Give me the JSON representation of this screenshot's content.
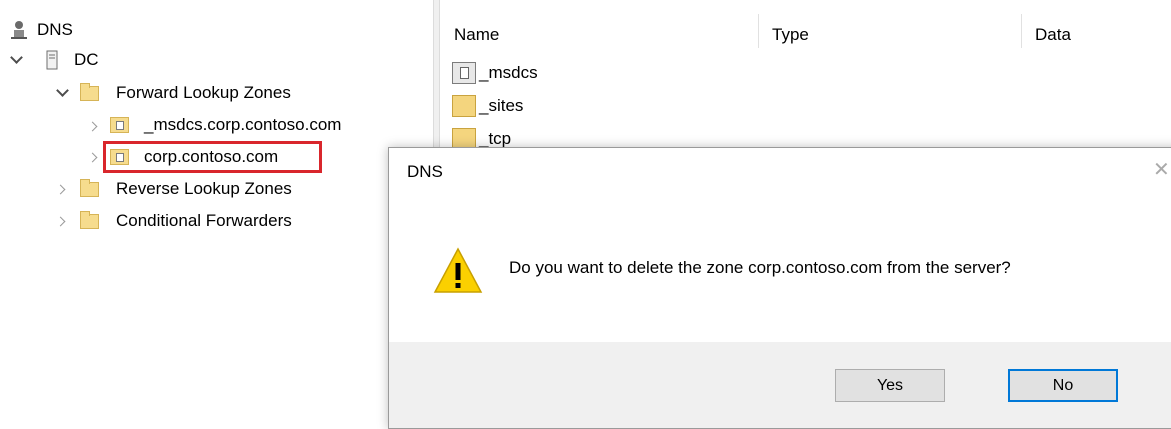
{
  "tree": {
    "root": "DNS",
    "server": "DC",
    "forward_zones": "Forward Lookup Zones",
    "zone_msdcs": "_msdcs.corp.contoso.com",
    "zone_corp": "corp.contoso.com",
    "reverse_zones": "Reverse Lookup Zones",
    "conditional_forwarders": "Conditional Forwarders"
  },
  "list": {
    "columns": [
      "Name",
      "Type",
      "Data"
    ],
    "rows": [
      "_msdcs",
      "_sites",
      "_tcp"
    ]
  },
  "dialog": {
    "title": "DNS",
    "close": "✕",
    "message": "Do you want to delete the zone corp.contoso.com from the server?",
    "yes": "Yes",
    "no": "No"
  },
  "colors": {
    "selection_outline": "#d9262c",
    "default_button_border": "#0078d7",
    "warning_fill": "#fbd000"
  }
}
